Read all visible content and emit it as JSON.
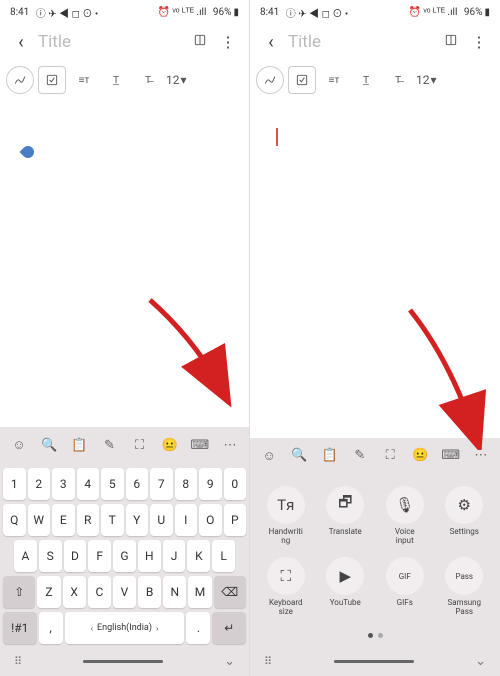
{
  "status": {
    "time": "8:41",
    "icons": "ⓘ ✈ ◀ ◻ ⊙ •",
    "net": "⏰ ᵛᵒ ᴸᵀᴱ .ıll",
    "battery": "96%",
    "batt_icon": "▮"
  },
  "app": {
    "title": "Title",
    "back": "‹",
    "reader": "⧉",
    "more": "⋮"
  },
  "toolbar": {
    "pen": "〰",
    "check": "☑",
    "format": "≡т",
    "underline": "T̲",
    "strike": "T̶",
    "size": "12",
    "drop": "▾"
  },
  "kbdtop": [
    "☺",
    "🔍",
    "📋",
    "✎",
    "⛶",
    "😐",
    "⌨",
    "⋯"
  ],
  "rows": {
    "r1": [
      "1",
      "2",
      "3",
      "4",
      "5",
      "6",
      "7",
      "8",
      "9",
      "0"
    ],
    "r2": [
      "Q",
      "W",
      "E",
      "R",
      "T",
      "Y",
      "U",
      "I",
      "O",
      "P"
    ],
    "r3": [
      "A",
      "S",
      "D",
      "F",
      "G",
      "H",
      "J",
      "K",
      "L"
    ],
    "r4": [
      "⇧",
      "Z",
      "X",
      "C",
      "V",
      "B",
      "N",
      "M",
      "⌫"
    ],
    "r5": {
      "sym": "!#1",
      "comma": ",",
      "lang": "English(India)",
      "dot": ".",
      "enter": "↵"
    }
  },
  "panel": {
    "r1": [
      {
        "icon": "Tя",
        "label": "Handwriti\nng",
        "name": "handwriting"
      },
      {
        "icon": "🗗",
        "label": "Translate",
        "name": "translate"
      },
      {
        "icon": "🎙",
        "label": "Voice\ninput",
        "name": "voice-input"
      },
      {
        "icon": "⚙",
        "label": "Settings",
        "name": "settings"
      }
    ],
    "r2": [
      {
        "icon": "⛶",
        "label": "Keyboard\nsize",
        "name": "keyboard-size"
      },
      {
        "icon": "▶",
        "label": "YouTube",
        "name": "youtube"
      },
      {
        "icon": "GIF",
        "label": "GIFs",
        "name": "gifs"
      },
      {
        "icon": "Pass",
        "label": "Samsung\nPass",
        "name": "samsung-pass"
      }
    ]
  },
  "bottom": {
    "grid": "⠿",
    "down": "⌄"
  }
}
